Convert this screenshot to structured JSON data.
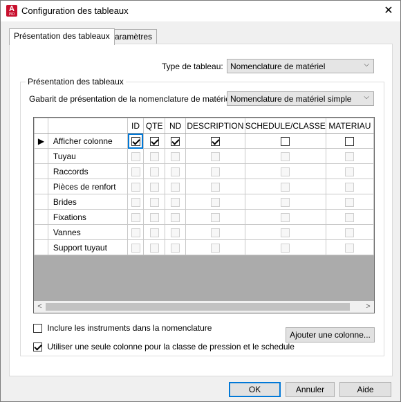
{
  "window": {
    "title": "Configuration des tableaux",
    "close_glyph": "✕",
    "app_icon": "autocad-plant-icon",
    "app_icon_letter": "A",
    "app_icon_sub": "PID"
  },
  "tabs": [
    {
      "label": "Présentation des tableaux",
      "active": true
    },
    {
      "label": "Paramètres",
      "active": false
    }
  ],
  "table_type": {
    "label": "Type de tableau:",
    "value": "Nomenclature de matériel"
  },
  "group": {
    "title": "Présentation des tableaux",
    "template_label": "Gabarit de présentation de la nomenclature de matériel:",
    "template_value": "Nomenclature de matériel simple"
  },
  "grid": {
    "columns": [
      "ID",
      "QTE",
      "ND",
      "DESCRIPTION",
      "SCHEDULE/CLASSE",
      "MATERIAU"
    ],
    "current_row_glyph": "▶",
    "rows": [
      {
        "name": "Afficher colonne",
        "enabled": true,
        "checks": [
          true,
          true,
          true,
          true,
          false,
          false
        ]
      },
      {
        "name": "Tuyau",
        "enabled": false,
        "checks": [
          false,
          false,
          false,
          false,
          false,
          false
        ]
      },
      {
        "name": "Raccords",
        "enabled": false,
        "checks": [
          false,
          false,
          false,
          false,
          false,
          false
        ]
      },
      {
        "name": "Pièces de renfort",
        "enabled": false,
        "checks": [
          false,
          false,
          false,
          false,
          false,
          false
        ]
      },
      {
        "name": "Brides",
        "enabled": false,
        "checks": [
          false,
          false,
          false,
          false,
          false,
          false
        ]
      },
      {
        "name": "Fixations",
        "enabled": false,
        "checks": [
          false,
          false,
          false,
          false,
          false,
          false
        ]
      },
      {
        "name": "Vannes",
        "enabled": false,
        "checks": [
          false,
          false,
          false,
          false,
          false,
          false
        ]
      },
      {
        "name": "Support tuyaut",
        "enabled": false,
        "checks": [
          false,
          false,
          false,
          false,
          false,
          false
        ]
      }
    ],
    "scroll_left": "<",
    "scroll_right": ">"
  },
  "options": {
    "include_instruments": {
      "label": "Inclure les instruments dans la nomenclature",
      "checked": false
    },
    "single_column": {
      "label": "Utiliser une seule colonne pour la classe de pression et le schedule",
      "checked": true
    }
  },
  "buttons": {
    "add_column": "Ajouter une colonne...",
    "ok": "OK",
    "cancel": "Annuler",
    "help": "Aide"
  },
  "colors": {
    "accent": "#0078d7",
    "icon_red": "#c8102e",
    "grid_empty": "#ababab"
  }
}
